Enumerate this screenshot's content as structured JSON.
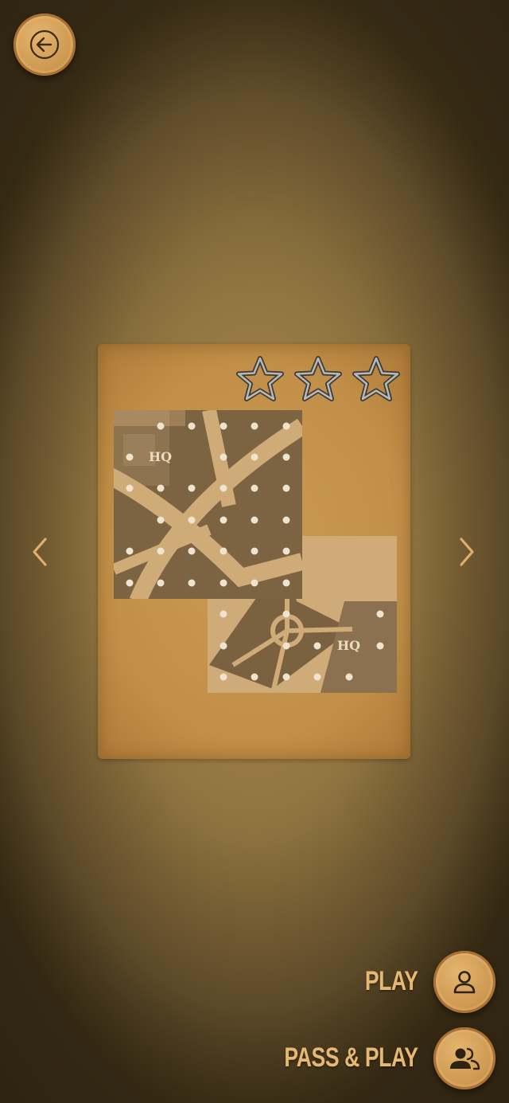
{
  "controls": {
    "back_icon": "arrow-left-icon",
    "prev_icon": "chevron-left-icon",
    "next_icon": "chevron-right-icon"
  },
  "level_card": {
    "stars_earned": 0,
    "stars_total": 3,
    "map_labels": [
      "HQ",
      "HQ"
    ]
  },
  "actions": {
    "play_label": "PLAY",
    "play_icon": "single-user-icon",
    "pass_play_label": "PASS & PLAY",
    "pass_play_icon": "two-users-icon"
  },
  "colors": {
    "accent": "#e7b873",
    "button": "#cf9a52",
    "card": "#c99a53"
  }
}
